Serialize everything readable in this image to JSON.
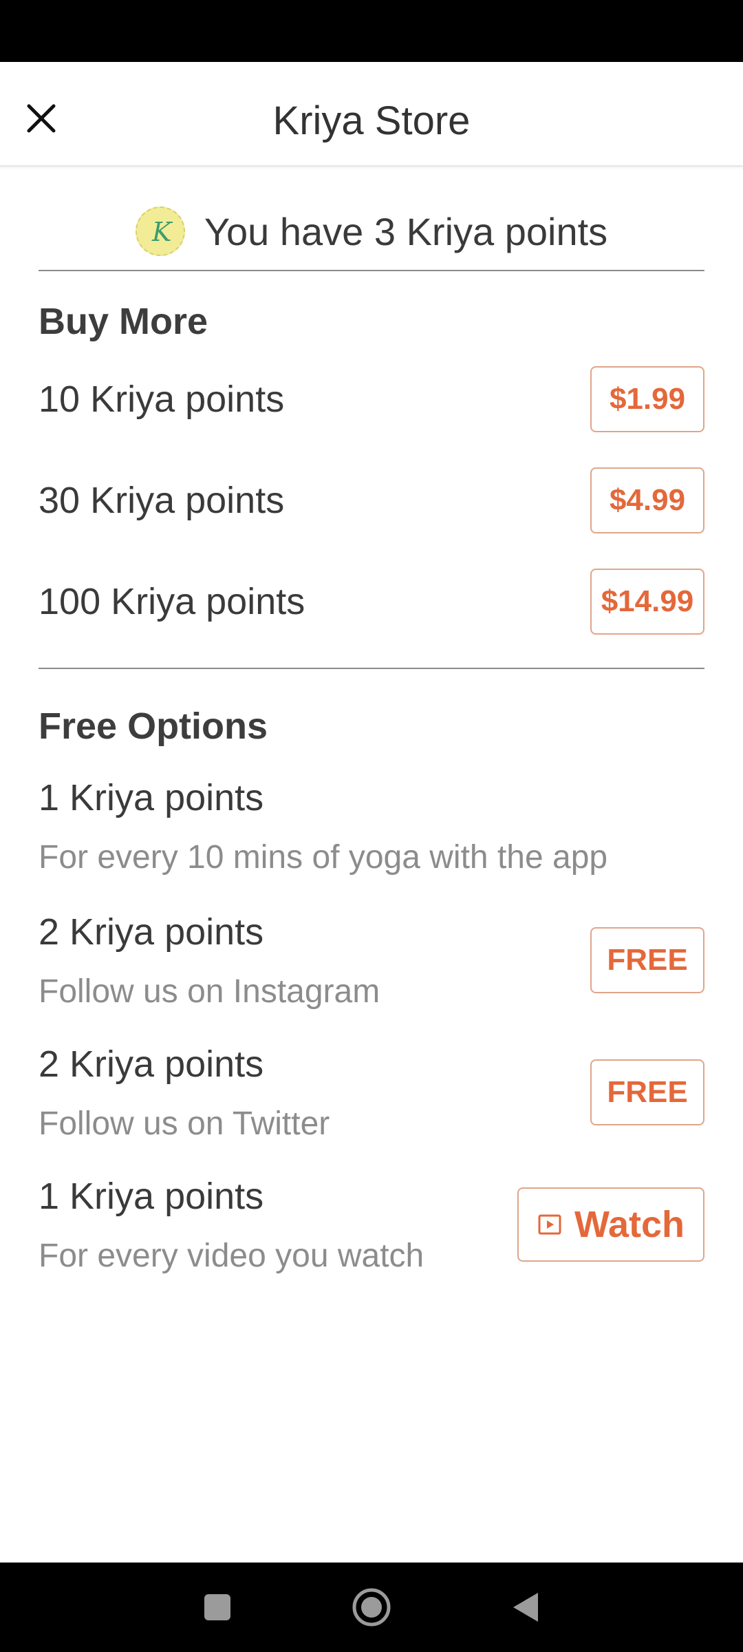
{
  "app_bar": {
    "title": "Kriya Store",
    "close_icon": "close-icon"
  },
  "balance": {
    "coin_letter": "K",
    "text": "You have 3 Kriya points"
  },
  "buy_more": {
    "title": "Buy More",
    "items": [
      {
        "label": "10 Kriya points",
        "price": "$1.99"
      },
      {
        "label": "30 Kriya points",
        "price": "$4.99"
      },
      {
        "label": "100 Kriya points",
        "price": "$14.99"
      }
    ]
  },
  "free_options": {
    "title": "Free Options",
    "items": [
      {
        "label": "1 Kriya points",
        "subtitle": "For every 10 mins of yoga with the app"
      },
      {
        "label": "2 Kriya points",
        "subtitle": "Follow us on Instagram",
        "button": "FREE"
      },
      {
        "label": "2 Kriya points",
        "subtitle": "Follow us on Twitter",
        "button": "FREE"
      },
      {
        "label": "1 Kriya points",
        "subtitle": "For every video you watch",
        "button": "Watch"
      }
    ]
  },
  "colors": {
    "accent": "#e4683a",
    "coin": "#f3ec96",
    "coin_letter": "#3a9e6e",
    "text": "#3a3a3a",
    "subtext": "#8c8c8c"
  },
  "nav": {
    "icons": [
      "recents-icon",
      "home-icon",
      "back-icon"
    ]
  }
}
